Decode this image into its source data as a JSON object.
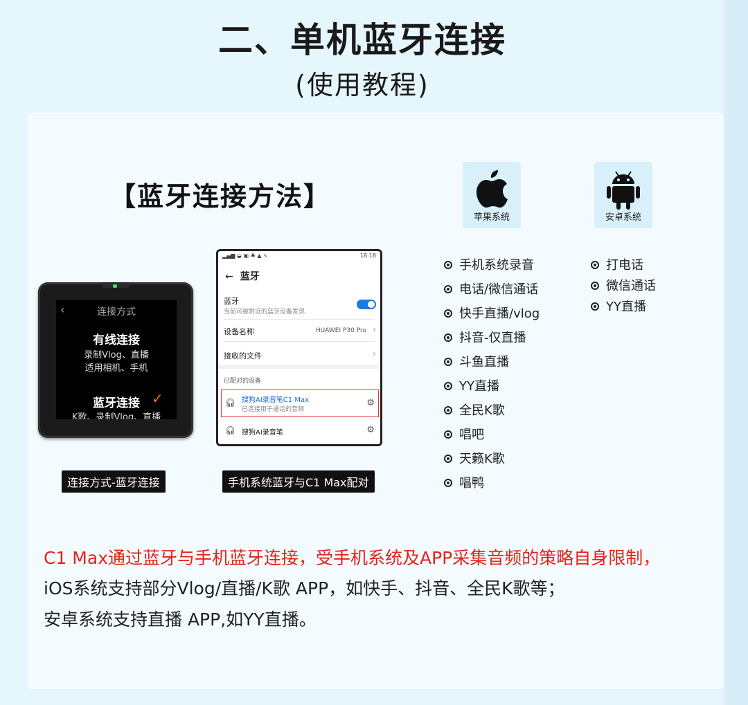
{
  "page": {
    "title": "二、单机蓝牙连接",
    "subtitle": "(使用教程)",
    "method_title": "【蓝牙连接方法】"
  },
  "device": {
    "back_icon": "chevron-left-icon",
    "header": "连接方式",
    "option1": "有线连接",
    "option1_line1": "录制Vlog、直播",
    "option1_line2": "适用相机、手机",
    "option2": "蓝牙连接",
    "option2_line1": "K歌、录制Vlog、直播",
    "check_icon": "check-icon",
    "caption": "连接方式-蓝牙连接"
  },
  "phone": {
    "status_right": "18:18",
    "header": "蓝牙",
    "bt_label": "蓝牙",
    "bt_sub": "当前可被附近的蓝牙设备发现",
    "device_name_label": "设备名称",
    "device_name_value": "HUAWEI P30 Pro",
    "received_files": "接收的文件",
    "paired_label": "已配对的设备",
    "paired1_name": "搜狗AI录音笔C1 Max",
    "paired1_sub": "已连接用于通话的音频",
    "paired2_name": "搜狗AI录音笔",
    "caption": "手机系统蓝牙与C1 Max配对"
  },
  "os": {
    "ios_label": "苹果系统",
    "android_label": "安卓系统"
  },
  "ios_apps": [
    "手机系统录音",
    "电话/微信通话",
    "快手直播/vlog",
    "抖音-仅直播",
    "斗鱼直播",
    "YY直播",
    "全民K歌",
    "唱吧",
    "天籁K歌",
    "唱鸭"
  ],
  "android_apps": [
    "打电话",
    "微信通话",
    "YY直播"
  ],
  "notes": {
    "line1": "C1 Max通过蓝牙与手机蓝牙连接，受手机系统及APP采集音频的策略自身限制，",
    "line2": "iOS系统支持部分Vlog/直播/K歌 APP，如快手、抖音、全民K歌等；",
    "line3": "安卓系统支持直播 APP,如YY直播。"
  },
  "colors": {
    "background": "#e6f6fd",
    "card": "#f4fbfe",
    "accent_red": "#e2231a",
    "toggle_blue": "#1a7ce0",
    "check_orange": "#ff6a2a"
  }
}
